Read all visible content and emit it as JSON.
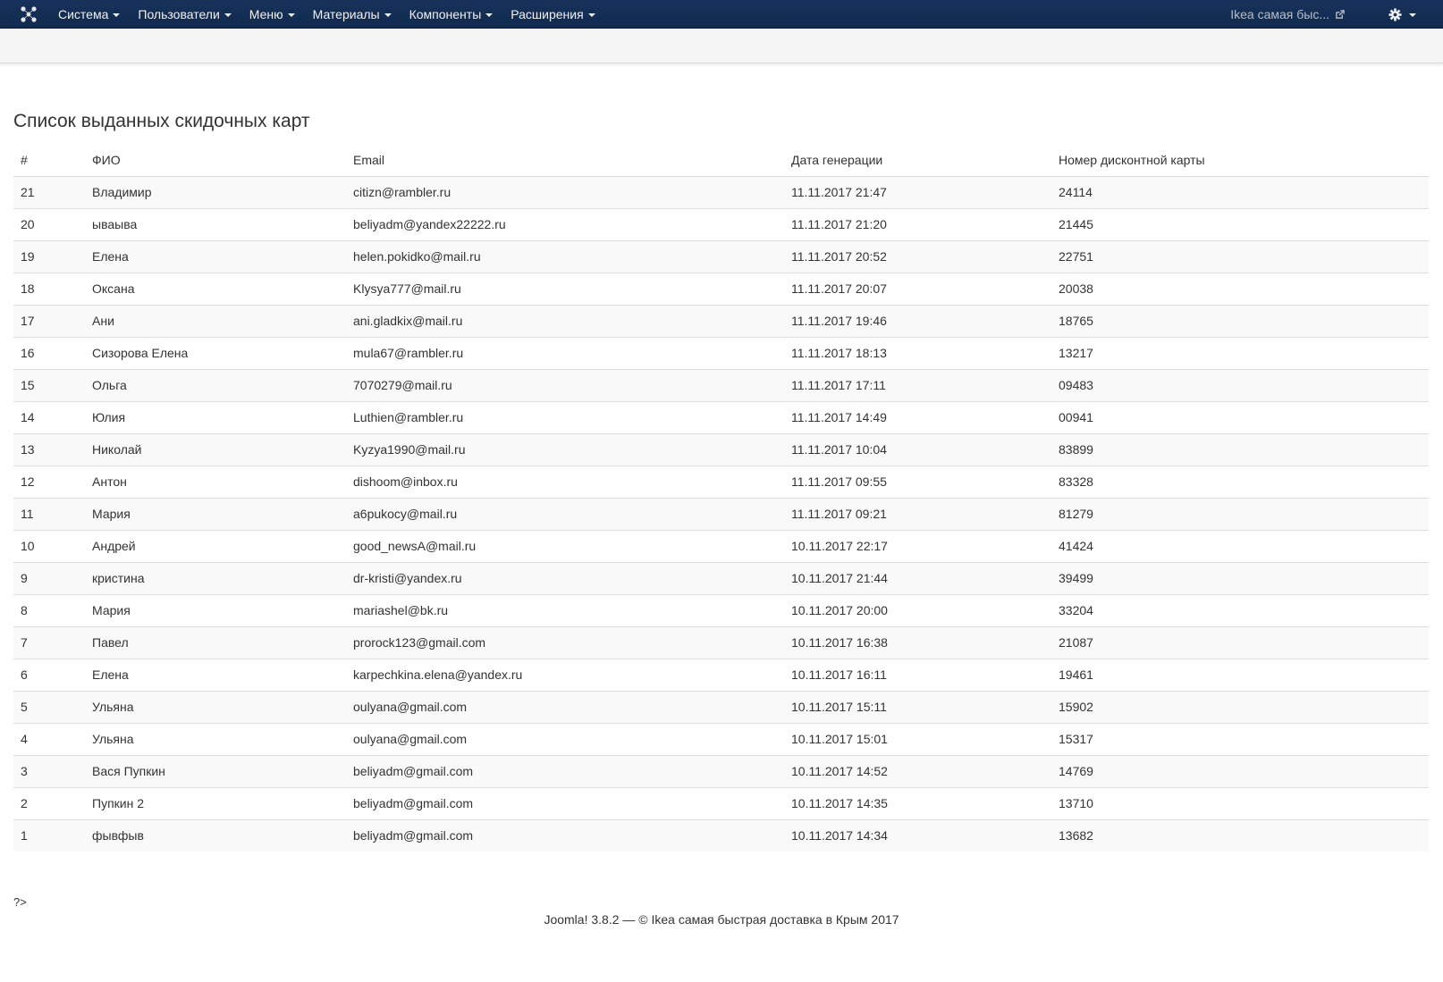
{
  "navbar": {
    "menu": [
      {
        "label": "Система"
      },
      {
        "label": "Пользователи"
      },
      {
        "label": "Меню"
      },
      {
        "label": "Материалы"
      },
      {
        "label": "Компоненты"
      },
      {
        "label": "Расширения"
      }
    ],
    "site_link": "Ikea самая быс...",
    "colors": {
      "background": "#132f57",
      "text": "#f0f0f0"
    }
  },
  "main": {
    "title": "Список выданных скидочных карт",
    "columns": [
      "#",
      "ФИО",
      "Email",
      "Дата генерации",
      "Номер дисконтной карты"
    ],
    "rows": [
      [
        "21",
        "Владимир",
        "citizn@rambler.ru",
        "11.11.2017 21:47",
        "24114"
      ],
      [
        "20",
        "ываыва",
        "beliyadm@yandex22222.ru",
        "11.11.2017 21:20",
        "21445"
      ],
      [
        "19",
        "Елена",
        "helen.pokidko@mail.ru",
        "11.11.2017 20:52",
        "22751"
      ],
      [
        "18",
        "Оксана",
        "Klysya777@mail.ru",
        "11.11.2017 20:07",
        "20038"
      ],
      [
        "17",
        "Ани",
        "ani.gladkix@mail.ru",
        "11.11.2017 19:46",
        "18765"
      ],
      [
        "16",
        "Сизорова Елена",
        "mula67@rambler.ru",
        "11.11.2017 18:13",
        "13217"
      ],
      [
        "15",
        "Ольга",
        "7070279@mail.ru",
        "11.11.2017 17:11",
        "09483"
      ],
      [
        "14",
        "Юлия",
        "Luthien@rambler.ru",
        "11.11.2017 14:49",
        "00941"
      ],
      [
        "13",
        "Николай",
        "Kyzya1990@mail.ru",
        "11.11.2017 10:04",
        "83899"
      ],
      [
        "12",
        "Антон",
        "dishoom@inbox.ru",
        "11.11.2017 09:55",
        "83328"
      ],
      [
        "11",
        "Мария",
        "a6pukocy@mail.ru",
        "11.11.2017 09:21",
        "81279"
      ],
      [
        "10",
        "Андрей",
        "good_newsA@mail.ru",
        "10.11.2017 22:17",
        "41424"
      ],
      [
        "9",
        "кристина",
        "dr-kristi@yandex.ru",
        "10.11.2017 21:44",
        "39499"
      ],
      [
        "8",
        "Мария",
        "mariashel@bk.ru",
        "10.11.2017 20:00",
        "33204"
      ],
      [
        "7",
        "Павел",
        "prorock123@gmail.com",
        "10.11.2017 16:38",
        "21087"
      ],
      [
        "6",
        "Елена",
        "karpechkina.elena@yandex.ru",
        "10.11.2017 16:11",
        "19461"
      ],
      [
        "5",
        "Ульяна",
        "oulyana@gmail.com",
        "10.11.2017 15:11",
        "15902"
      ],
      [
        "4",
        "Ульяна",
        "oulyana@gmail.com",
        "10.11.2017 15:01",
        "15317"
      ],
      [
        "3",
        "Вася Пупкин",
        "beliyadm@gmail.com",
        "10.11.2017 14:52",
        "14769"
      ],
      [
        "2",
        "Пупкин 2",
        "beliyadm@gmail.com",
        "10.11.2017 14:35",
        "13710"
      ],
      [
        "1",
        "фывфыв",
        "beliyadm@gmail.com",
        "10.11.2017 14:34",
        "13682"
      ]
    ],
    "php_tail": "?>"
  },
  "footer": {
    "text": "Joomla! 3.8.2  —  © Ikea самая быстрая доставка в Крым 2017"
  },
  "icons": {
    "logo": "joomla-logo-icon",
    "site_link": "external-link-icon",
    "settings": "gear-icon"
  }
}
